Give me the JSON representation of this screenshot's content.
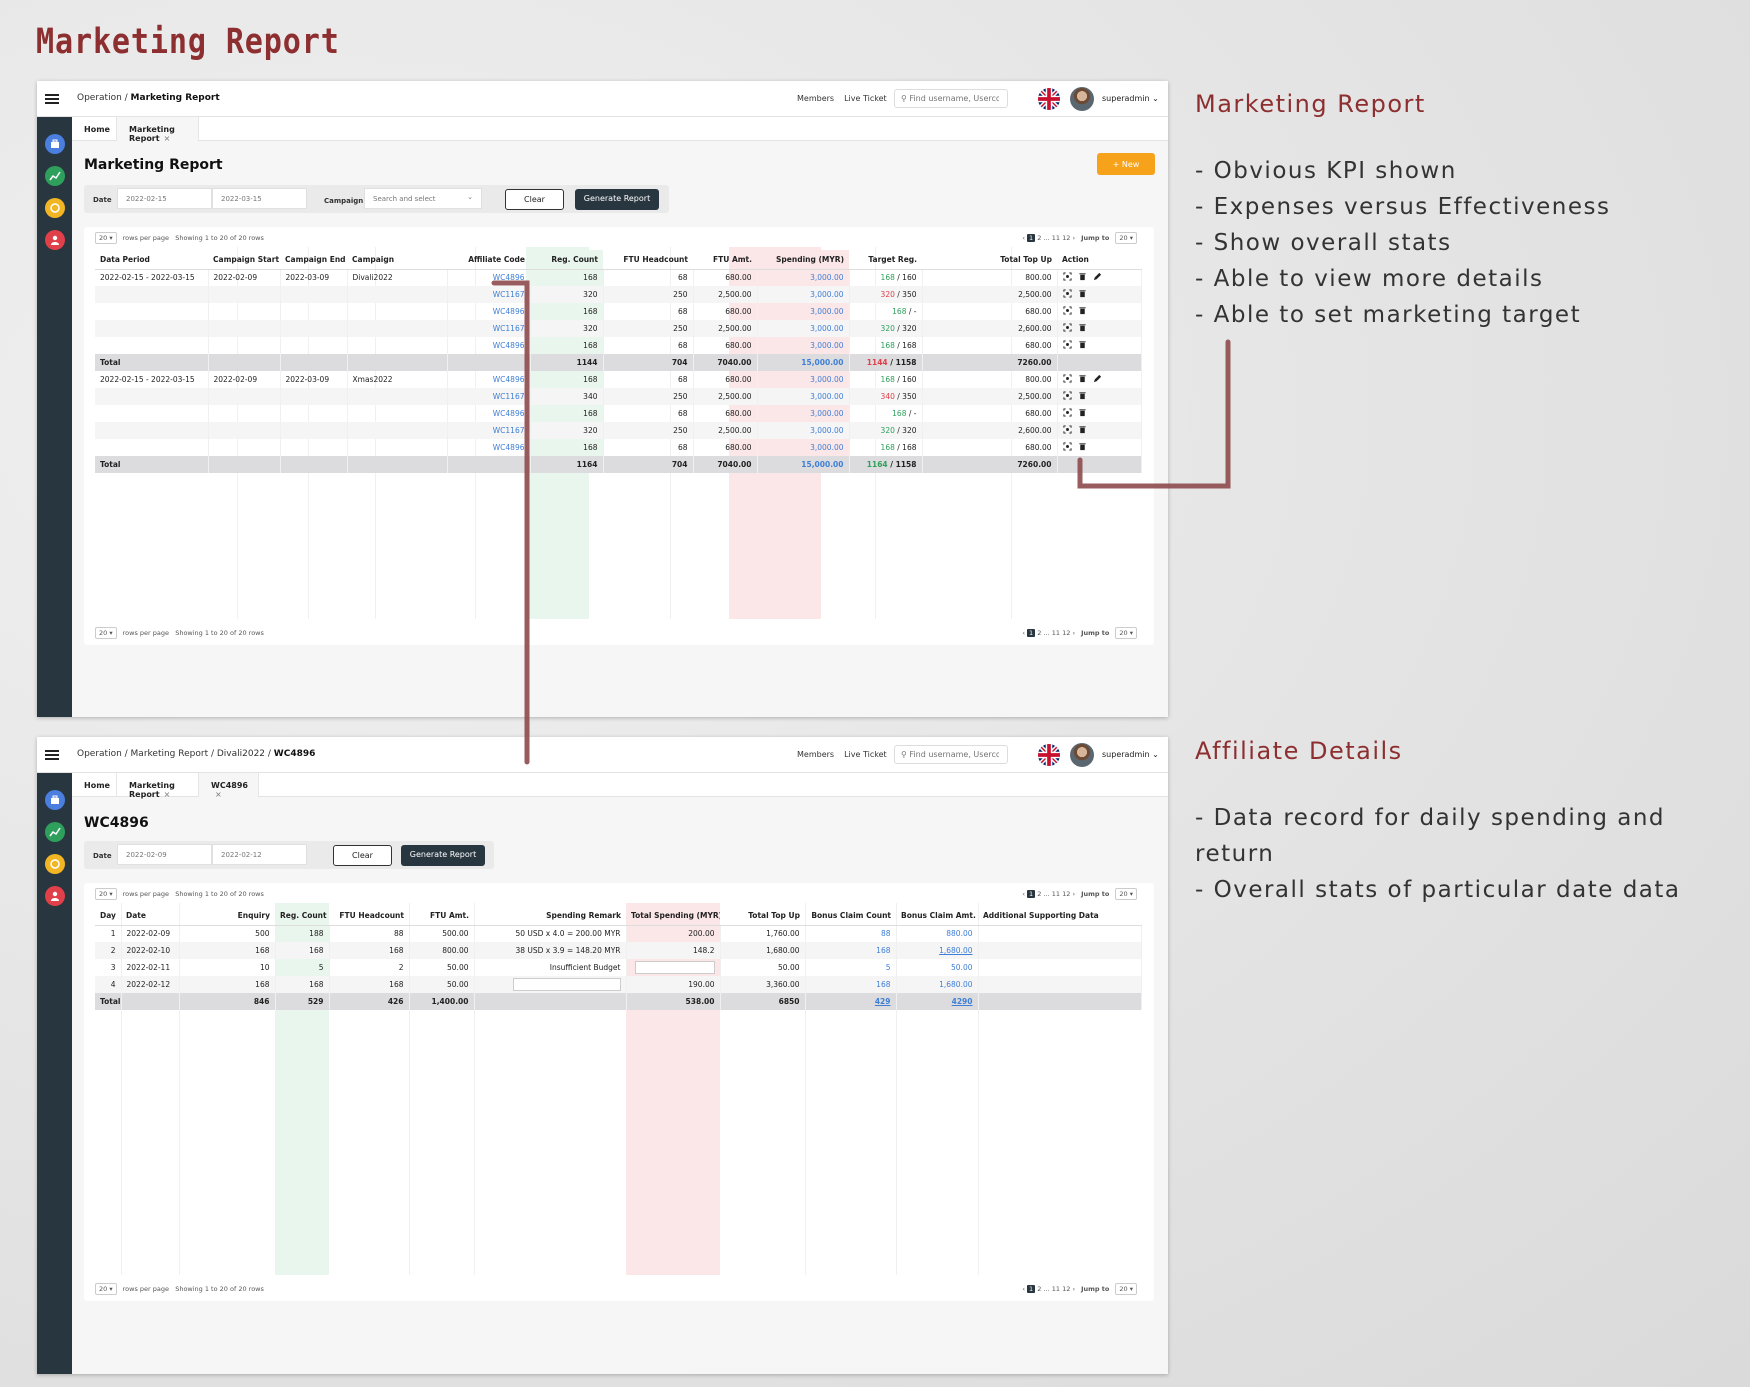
{
  "title": "Marketing Report",
  "right_panel": {
    "section1_title": "Marketing Report",
    "section1_points": [
      "- Obvious KPI shown",
      "- Expenses versus Effectiveness",
      "- Show overall stats",
      "- Able to view more details",
      "- Able to set marketing target"
    ],
    "section2_title": "Affiliate Details",
    "section2_points": [
      "- Data record for daily spending and",
      "return",
      "- Overall stats of particular date data"
    ]
  },
  "colors": {
    "accent": "#8d2f30",
    "sidebar": "#283640",
    "new_button": "#f7a21b",
    "link": "#3f7fd6",
    "green": "#2ea05c",
    "red": "#e0404a"
  },
  "topbar": {
    "members": "Members",
    "live_ticket": "Live Ticket",
    "search_placeholder": "Find username, Userco",
    "user": "superadmin"
  },
  "screen1": {
    "breadcrumb_prefix": "Operation / ",
    "breadcrumb_current": "Marketing Report",
    "tabs": [
      {
        "label": "Home"
      },
      {
        "label": "Marketing Report",
        "close": "×"
      }
    ],
    "heading": "Marketing Report",
    "new_button": "+ New",
    "filter": {
      "date_label": "Date",
      "date_from": "2022-02-15",
      "date_to": "2022-03-15",
      "campaign_label": "Campaign",
      "campaign_placeholder": "Search and select",
      "clear": "Clear",
      "generate": "Generate Report"
    },
    "pagination": {
      "rows": "20",
      "rows_label": "rows per page",
      "showing": "Showing 1 to 20 of 20 rows",
      "pages_top": [
        "1",
        "2",
        "...",
        "11",
        "12"
      ],
      "pages_bottom": [
        "1",
        "2",
        "...",
        "11",
        "12"
      ],
      "jump_label": "Jump to",
      "jump_value": "20"
    },
    "columns": [
      "Data Period",
      "Campaign Start",
      "Campaign End",
      "Campaign",
      "Affiliate Code",
      "Reg. Count",
      "FTU Headcount",
      "FTU Amt.",
      "Spending (MYR)",
      "Target Reg.",
      "Total Top Up",
      "Action"
    ],
    "rows": [
      [
        "2022-02-15 - 2022-03-15",
        "2022-02-09",
        "2022-03-09",
        "Divali2022",
        "WC4896",
        "168",
        "68",
        "680.00",
        "3,000.00",
        "168",
        "/ 160",
        "800.00"
      ],
      [
        "",
        "",
        "",
        "",
        "WC1167",
        "320",
        "250",
        "2,500.00",
        "3,000.00",
        "320",
        "/ 350",
        "2,500.00"
      ],
      [
        "",
        "",
        "",
        "",
        "WC4896",
        "168",
        "68",
        "680.00",
        "3,000.00",
        "168",
        "/ -",
        "680.00"
      ],
      [
        "",
        "",
        "",
        "",
        "WC1167",
        "320",
        "250",
        "2,500.00",
        "3,000.00",
        "320",
        "/ 320",
        "2,600.00"
      ],
      [
        "",
        "",
        "",
        "",
        "WC4896",
        "168",
        "68",
        "680.00",
        "3,000.00",
        "168",
        "/ 168",
        "680.00"
      ],
      [
        "Total",
        "",
        "",
        "",
        "",
        "1144",
        "704",
        "7040.00",
        "15,000.00",
        "1144",
        "/ 1158",
        "7260.00"
      ],
      [
        "2022-02-15 - 2022-03-15",
        "2022-02-09",
        "2022-03-09",
        "Xmas2022",
        "WC4896",
        "168",
        "68",
        "680.00",
        "3,000.00",
        "168",
        "/ 160",
        "800.00"
      ],
      [
        "",
        "",
        "",
        "",
        "WC1167",
        "340",
        "250",
        "2,500.00",
        "3,000.00",
        "340",
        "/ 350",
        "2,500.00"
      ],
      [
        "",
        "",
        "",
        "",
        "WC4896",
        "168",
        "68",
        "680.00",
        "3,000.00",
        "168",
        "/ -",
        "680.00"
      ],
      [
        "",
        "",
        "",
        "",
        "WC1167",
        "320",
        "250",
        "2,500.00",
        "3,000.00",
        "320",
        "/ 320",
        "2,600.00"
      ],
      [
        "",
        "",
        "",
        "",
        "WC4896",
        "168",
        "68",
        "680.00",
        "3,000.00",
        "168",
        "/ 168",
        "680.00"
      ],
      [
        "Total",
        "",
        "",
        "",
        "",
        "1164",
        "704",
        "7040.00",
        "15,000.00",
        "1164",
        "/ 1158",
        "7260.00"
      ]
    ],
    "target_status": [
      "green",
      "red",
      "green",
      "green",
      "green",
      "red",
      "green",
      "red",
      "green",
      "green",
      "green",
      "green"
    ]
  },
  "screen2": {
    "breadcrumb_prefix": "Operation / Marketing Report / Divali2022 / ",
    "breadcrumb_current": "WC4896",
    "tabs": [
      {
        "label": "Home"
      },
      {
        "label": "Marketing Report",
        "close": "×"
      },
      {
        "label": "WC4896",
        "close": "×"
      }
    ],
    "heading": "WC4896",
    "filter": {
      "date_label": "Date",
      "date_from": "2022-02-09",
      "date_to": "2022-02-12",
      "clear": "Clear",
      "generate": "Generate Report"
    },
    "pagination": {
      "rows": "20",
      "rows_label": "rows per page",
      "showing": "Showing 1 to 20 of 20 rows",
      "pages_top": [
        "1",
        "2",
        "...",
        "11",
        "12"
      ],
      "pages_bottom": [
        "1",
        "2",
        "...",
        "11",
        "12"
      ],
      "jump_label": "Jump to",
      "jump_value": "20"
    },
    "columns": [
      "Day",
      "Date",
      "Enquiry",
      "Reg. Count",
      "FTU Headcount",
      "FTU Amt.",
      "Spending Remark",
      "Total Spending (MYR)",
      "Total Top Up",
      "Bonus Claim Count",
      "Bonus Claim Amt.",
      "Additional Supporting Data"
    ],
    "rows": [
      [
        "1",
        "2022-02-09",
        "500",
        "188",
        "88",
        "500.00",
        "50 USD x 4.0 = 200.00 MYR",
        "200.00",
        "1,760.00",
        "88",
        "880.00",
        ""
      ],
      [
        "2",
        "2022-02-10",
        "168",
        "168",
        "168",
        "800.00",
        "38 USD x 3.9 = 148.20 MYR",
        "148.2",
        "1,680.00",
        "168",
        "1,680.00",
        ""
      ],
      [
        "3",
        "2022-02-11",
        "10",
        "5",
        "2",
        "50.00",
        "Insufficient Budget",
        "",
        "50.00",
        "5",
        "50.00",
        ""
      ],
      [
        "4",
        "2022-02-12",
        "168",
        "168",
        "168",
        "50.00",
        "",
        "190.00",
        "3,360.00",
        "168",
        "1,680.00",
        ""
      ],
      [
        "Total",
        "",
        "846",
        "529",
        "426",
        "1,400.00",
        "",
        "538.00",
        "6850",
        "429",
        "4290",
        ""
      ]
    ]
  }
}
